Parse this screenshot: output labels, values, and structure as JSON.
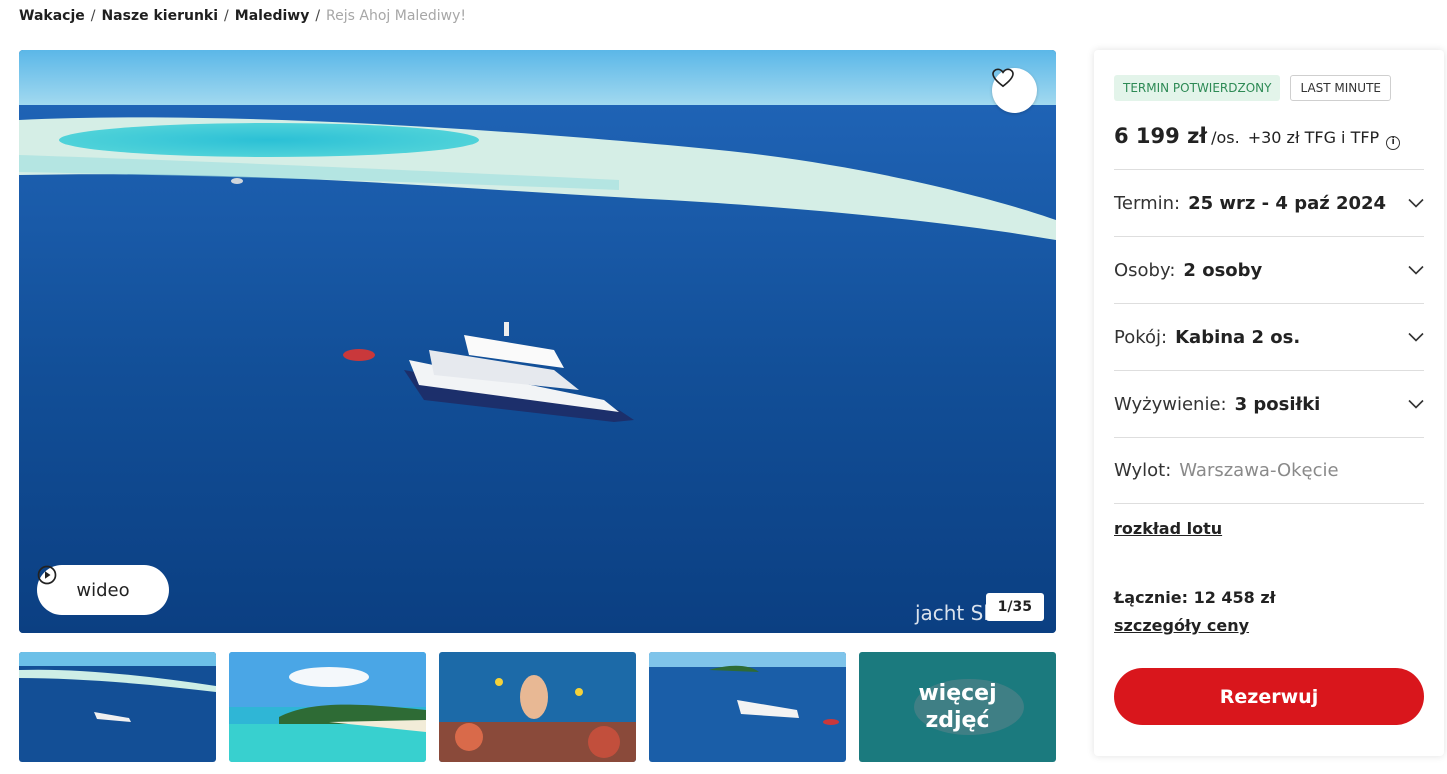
{
  "breadcrumb": {
    "items": [
      "Wakacje",
      "Nasze kierunki",
      "Malediwy"
    ],
    "current": "Rejs Ahoj Malediwy!",
    "separator": "/"
  },
  "gallery": {
    "video_label": "wideo",
    "counter": "1/35",
    "watermark": "jacht Sh",
    "more_label_line1": "więcej",
    "more_label_line2": "zdjęć"
  },
  "offer": {
    "badge_confirmed": "TERMIN POTWIERDZONY",
    "badge_last_minute": "LAST MINUTE",
    "price": "6 199 zł",
    "price_unit": "/os.",
    "price_extra": "+30 zł TFG i TFP",
    "rows": [
      {
        "label": "Termin:",
        "value": "25 wrz - 4 paź 2024"
      },
      {
        "label": "Osoby:",
        "value": "2 osoby"
      },
      {
        "label": "Pokój:",
        "value": "Kabina 2 os."
      },
      {
        "label": "Wyżywienie:",
        "value": "3 posiłki"
      },
      {
        "label": "Wylot:",
        "value": "Warszawa-Okęcie"
      }
    ],
    "flight_link": "rozkład lotu",
    "total": "Łącznie: 12 458 zł",
    "price_details_link": "szczegóły ceny",
    "book_label": "Rezerwuj"
  },
  "colors": {
    "accent": "#d9161c",
    "badge_green_bg": "#e3f4ea",
    "badge_green_text": "#2d8a55"
  }
}
